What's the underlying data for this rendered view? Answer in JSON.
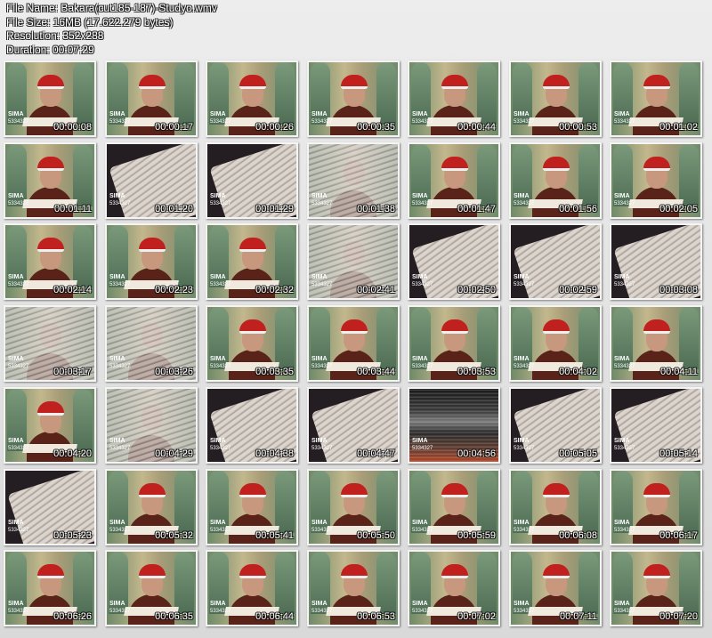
{
  "header": {
    "file_name": "File Name: Bakara(cut185-187)-Studyo.wmv",
    "file_size": "File Size: 16MB (17.622.279 bytes)",
    "resolution": "Resolution: 352x288",
    "duration": "Duration: 00:07:29"
  },
  "logo": {
    "text": "SIMA",
    "sub": "5334327"
  },
  "thumbnails": [
    {
      "time": "00:00:08",
      "scene": "studio"
    },
    {
      "time": "00:00:17",
      "scene": "studio"
    },
    {
      "time": "00:00:26",
      "scene": "studio"
    },
    {
      "time": "00:00:35",
      "scene": "studio"
    },
    {
      "time": "00:00:44",
      "scene": "studio"
    },
    {
      "time": "00:00:53",
      "scene": "studio"
    },
    {
      "time": "00:01:02",
      "scene": "studio"
    },
    {
      "time": "00:01:11",
      "scene": "studio"
    },
    {
      "time": "00:01:20",
      "scene": "book"
    },
    {
      "time": "00:01:29",
      "scene": "book"
    },
    {
      "time": "00:01:38",
      "scene": "mix"
    },
    {
      "time": "00:01:47",
      "scene": "studio"
    },
    {
      "time": "00:01:56",
      "scene": "studio"
    },
    {
      "time": "00:02:05",
      "scene": "studio"
    },
    {
      "time": "00:02:14",
      "scene": "studio"
    },
    {
      "time": "00:02:23",
      "scene": "studio"
    },
    {
      "time": "00:02:32",
      "scene": "studio"
    },
    {
      "time": "00:02:41",
      "scene": "mix"
    },
    {
      "time": "00:02:50",
      "scene": "book"
    },
    {
      "time": "00:02:59",
      "scene": "book"
    },
    {
      "time": "00:03:08",
      "scene": "book"
    },
    {
      "time": "00:03:17",
      "scene": "mix"
    },
    {
      "time": "00:03:26",
      "scene": "mix"
    },
    {
      "time": "00:03:35",
      "scene": "studio"
    },
    {
      "time": "00:03:44",
      "scene": "studio"
    },
    {
      "time": "00:03:53",
      "scene": "studio"
    },
    {
      "time": "00:04:02",
      "scene": "studio"
    },
    {
      "time": "00:04:11",
      "scene": "studio"
    },
    {
      "time": "00:04:20",
      "scene": "studio"
    },
    {
      "time": "00:04:29",
      "scene": "mix"
    },
    {
      "time": "00:04:38",
      "scene": "book"
    },
    {
      "time": "00:04:47",
      "scene": "book"
    },
    {
      "time": "00:04:56",
      "scene": "noise"
    },
    {
      "time": "00:05:05",
      "scene": "book"
    },
    {
      "time": "00:05:14",
      "scene": "book"
    },
    {
      "time": "00:05:23",
      "scene": "book"
    },
    {
      "time": "00:05:32",
      "scene": "studio"
    },
    {
      "time": "00:05:41",
      "scene": "studio"
    },
    {
      "time": "00:05:50",
      "scene": "studio"
    },
    {
      "time": "00:05:59",
      "scene": "studio"
    },
    {
      "time": "00:06:08",
      "scene": "studio"
    },
    {
      "time": "00:06:17",
      "scene": "studio"
    },
    {
      "time": "00:06:26",
      "scene": "studio"
    },
    {
      "time": "00:06:35",
      "scene": "studio"
    },
    {
      "time": "00:06:44",
      "scene": "studio"
    },
    {
      "time": "00:06:53",
      "scene": "studio"
    },
    {
      "time": "00:07:02",
      "scene": "studio"
    },
    {
      "time": "00:07:11",
      "scene": "studio"
    },
    {
      "time": "00:07:20",
      "scene": "studio"
    }
  ]
}
